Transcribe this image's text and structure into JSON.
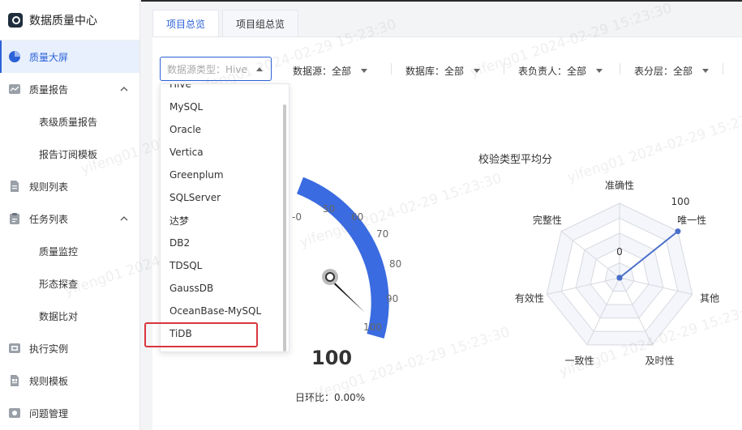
{
  "app": {
    "title": "数据质量中心"
  },
  "sidebar": {
    "items": [
      {
        "label": "质量大屏",
        "icon": "pie-chart-icon",
        "active": true
      },
      {
        "label": "质量报告",
        "icon": "report-icon",
        "expanded": true
      },
      {
        "label": "表级质量报告",
        "sub": true
      },
      {
        "label": "报告订阅模板",
        "sub": true
      },
      {
        "label": "规则列表",
        "icon": "document-icon"
      },
      {
        "label": "任务列表",
        "icon": "clipboard-icon",
        "expanded": true
      },
      {
        "label": "质量监控",
        "sub": true
      },
      {
        "label": "形态探查",
        "sub": true
      },
      {
        "label": "数据比对",
        "sub": true
      },
      {
        "label": "执行实例",
        "icon": "instance-icon"
      },
      {
        "label": "规则模板",
        "icon": "template-icon"
      },
      {
        "label": "问题管理",
        "icon": "issue-icon"
      }
    ]
  },
  "tabs": [
    {
      "label": "项目总览",
      "active": true
    },
    {
      "label": "项目组总览",
      "active": false
    }
  ],
  "filters": {
    "datasource_type": "数据源类型：Hive",
    "datasource": "数据源：全部",
    "database": "数据库：全部",
    "owner": "表负责人：全部",
    "layer": "表分层：全部"
  },
  "dropdown": {
    "partial": "Hive",
    "options": [
      "MySQL",
      "Oracle",
      "Vertica",
      "Greenplum",
      "SQLServer",
      "达梦",
      "DB2",
      "TDSQL",
      "GaussDB",
      "OceanBase-MySQL",
      "TiDB"
    ],
    "highlighted": "TiDB"
  },
  "gauge": {
    "value": "100",
    "ticks": [
      "-0",
      "50",
      "60",
      "70",
      "80",
      "90",
      "100"
    ],
    "daily_change": "日环比：0.00%",
    "accent": "#2c62d8"
  },
  "radar": {
    "title": "校验类型平均分",
    "axes": [
      "准确性",
      "唯一性",
      "其他",
      "及时性",
      "一致性",
      "有效性",
      "完整性"
    ],
    "scale_max": "100",
    "scale_min": "0",
    "values": [
      0,
      100,
      0,
      0,
      0,
      0,
      0
    ],
    "color": "#4a6fc9"
  },
  "watermark": "yifeng01 2024-02-29 15:23:30"
}
